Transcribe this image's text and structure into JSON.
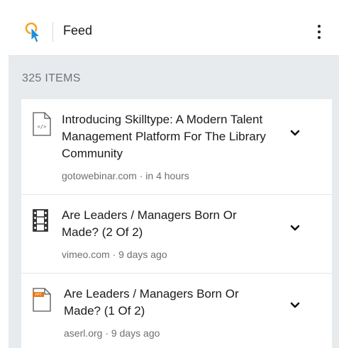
{
  "header": {
    "title": "Feed"
  },
  "section": {
    "label": "325 ITEMS"
  },
  "items": [
    {
      "title": "Introducing Skilltype: A Modern Talent Management Platform For The Library Community",
      "source": "gotowebinar.com",
      "time": "in 4 hours",
      "meta": "gotowebinar.com · in 4 hours",
      "icon": "code-file-icon"
    },
    {
      "title": "Are Leaders / Managers Born Or Made? (2 Of 2)",
      "source": "vimeo.com",
      "time": "9 days ago",
      "meta": "vimeo.com · 9 days ago",
      "icon": "film-icon"
    },
    {
      "title": "Are Leaders / Managers Born Or Made? (1 Of 2)",
      "source": "aserl.org",
      "time": "9 days ago",
      "meta": "aserl.org · 9 days ago",
      "icon": "presentation-file-icon",
      "icon_badge_text": "PPT"
    }
  ],
  "colors": {
    "accent": "#f5a623",
    "cursor_blue": "#1d8fe1",
    "background": "#e8ebee"
  }
}
